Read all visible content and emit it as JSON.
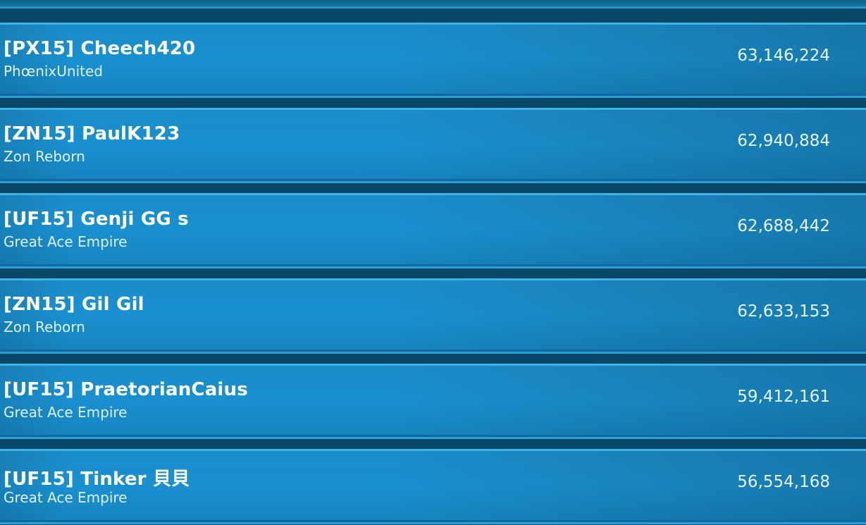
{
  "leaderboard": {
    "entries": [
      {
        "name": "[PX15] Cheech420",
        "alliance": "PhœnixUnited",
        "score": "63,146,224"
      },
      {
        "name": "[ZN15] PaulK123",
        "alliance": "Zon Reborn",
        "score": "62,940,884"
      },
      {
        "name": "[UF15] Genji GG s",
        "alliance": "Great Ace Empire",
        "score": "62,688,442"
      },
      {
        "name": "[ZN15] Gil Gil",
        "alliance": "Zon Reborn",
        "score": "62,633,153"
      },
      {
        "name": "[UF15] PraetorianCaius",
        "alliance": "Great Ace Empire",
        "score": "59,412,161"
      },
      {
        "name": "[UF15] Tinker 貝貝",
        "alliance": "Great Ace Empire",
        "score": "56,554,168"
      }
    ]
  },
  "colors": {
    "row_background": "#1a8fcd",
    "row_highlight": "#3fb3e6",
    "separator": "#0a4766",
    "text": "#ffffff"
  }
}
